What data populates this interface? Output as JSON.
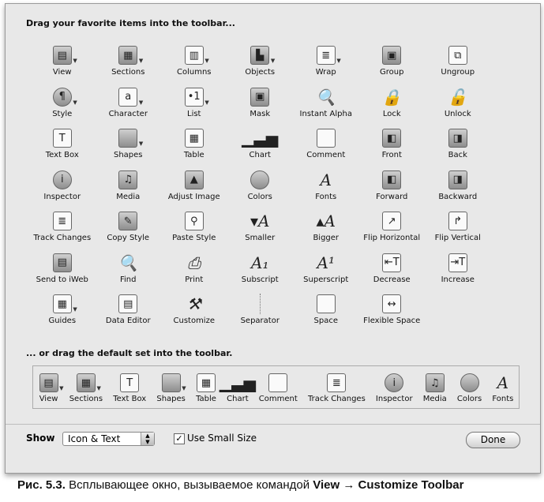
{
  "heading_all": "Drag your favorite items into the toolbar...",
  "heading_default": "... or drag the default set into the toolbar.",
  "items": [
    {
      "label": "View",
      "icon": "view-icon",
      "g": "▤",
      "t": 1
    },
    {
      "label": "Sections",
      "icon": "sections-icon",
      "g": "▦",
      "t": 1
    },
    {
      "label": "Columns",
      "icon": "columns-icon",
      "g": "▥",
      "t": 1,
      "s": "plain"
    },
    {
      "label": "Objects",
      "icon": "objects-icon",
      "g": "▙",
      "t": 1
    },
    {
      "label": "Wrap",
      "icon": "wrap-icon",
      "g": "≣",
      "t": 1,
      "s": "plain"
    },
    {
      "label": "Group",
      "icon": "group-icon",
      "g": "▣"
    },
    {
      "label": "Ungroup",
      "icon": "ungroup-icon",
      "g": "⧉",
      "s": "plain"
    },
    {
      "label": "Style",
      "icon": "style-icon",
      "g": "¶",
      "t": 1,
      "s": "round"
    },
    {
      "label": "Character",
      "icon": "character-icon",
      "g": "a",
      "t": 1,
      "s": "plain"
    },
    {
      "label": "List",
      "icon": "list-icon",
      "g": "•1",
      "t": 1,
      "s": "plain"
    },
    {
      "label": "Mask",
      "icon": "mask-icon",
      "g": "▣"
    },
    {
      "label": "Instant Alpha",
      "icon": "instant-alpha-icon",
      "g": "🔍",
      "s": "none"
    },
    {
      "label": "Lock",
      "icon": "lock-icon",
      "g": "🔒",
      "s": "none"
    },
    {
      "label": "Unlock",
      "icon": "unlock-icon",
      "g": "🔓",
      "s": "none"
    },
    {
      "label": "Text Box",
      "icon": "text-box-icon",
      "g": "T",
      "s": "plain"
    },
    {
      "label": "Shapes",
      "icon": "shapes-icon",
      "g": "",
      "t": 1
    },
    {
      "label": "Table",
      "icon": "table-icon",
      "g": "▦",
      "s": "plain"
    },
    {
      "label": "Chart",
      "icon": "chart-icon",
      "g": "▁▃▅",
      "s": "none"
    },
    {
      "label": "Comment",
      "icon": "comment-icon",
      "g": "",
      "s": "plain"
    },
    {
      "label": "Front",
      "icon": "bring-front-icon",
      "g": "◧"
    },
    {
      "label": "Back",
      "icon": "send-back-icon",
      "g": "◨"
    },
    {
      "label": "Inspector",
      "icon": "inspector-icon",
      "g": "i",
      "s": "round"
    },
    {
      "label": "Media",
      "icon": "media-icon",
      "g": "♫"
    },
    {
      "label": "Adjust Image",
      "icon": "adjust-image-icon",
      "g": "▲"
    },
    {
      "label": "Colors",
      "icon": "colors-icon",
      "g": "",
      "s": "round"
    },
    {
      "label": "Fonts",
      "icon": "fonts-icon",
      "g": "A",
      "s": "none"
    },
    {
      "label": "Forward",
      "icon": "forward-icon",
      "g": "◧"
    },
    {
      "label": "Backward",
      "icon": "backward-icon",
      "g": "◨"
    },
    {
      "label": "Track Changes",
      "icon": "track-changes-icon",
      "g": "≣",
      "s": "plain"
    },
    {
      "label": "Copy Style",
      "icon": "copy-style-icon",
      "g": "✎"
    },
    {
      "label": "Paste Style",
      "icon": "paste-style-icon",
      "g": "⚲",
      "s": "plain"
    },
    {
      "label": "Smaller",
      "icon": "smaller-icon",
      "g": "▾A",
      "s": "none"
    },
    {
      "label": "Bigger",
      "icon": "bigger-icon",
      "g": "▴A",
      "s": "none"
    },
    {
      "label": "Flip Horizontal",
      "icon": "flip-horizontal-icon",
      "g": "↗",
      "s": "plain"
    },
    {
      "label": "Flip Vertical",
      "icon": "flip-vertical-icon",
      "g": "↱",
      "s": "plain"
    },
    {
      "label": "Send to iWeb",
      "icon": "send-to-iweb-icon",
      "g": "▤"
    },
    {
      "label": "Find",
      "icon": "find-icon",
      "g": "🔍",
      "s": "none"
    },
    {
      "label": "Print",
      "icon": "print-icon",
      "g": "⎙",
      "s": "none"
    },
    {
      "label": "Subscript",
      "icon": "subscript-icon",
      "g": "A₁",
      "s": "none"
    },
    {
      "label": "Superscript",
      "icon": "superscript-icon",
      "g": "A¹",
      "s": "none"
    },
    {
      "label": "Decrease",
      "icon": "decrease-indent-icon",
      "g": "⇤T",
      "s": "plain"
    },
    {
      "label": "Increase",
      "icon": "increase-indent-icon",
      "g": "⇥T",
      "s": "plain"
    },
    {
      "label": "Guides",
      "icon": "guides-icon",
      "g": "▦",
      "t": 1,
      "s": "plain"
    },
    {
      "label": "Data Editor",
      "icon": "data-editor-icon",
      "g": "▤",
      "s": "plain"
    },
    {
      "label": "Customize",
      "icon": "customize-icon",
      "g": "⚒",
      "s": "none"
    },
    {
      "label": "Separator",
      "icon": "separator-icon",
      "sep": 1
    },
    {
      "label": "Space",
      "icon": "space-icon",
      "g": "",
      "s": "plain"
    },
    {
      "label": "Flexible Space",
      "icon": "flexible-space-icon",
      "g": "↔",
      "s": "plain"
    }
  ],
  "default_items": [
    {
      "label": "View",
      "icon": "view-icon",
      "g": "▤",
      "t": 1
    },
    {
      "label": "Sections",
      "icon": "sections-icon",
      "g": "▦",
      "t": 1
    },
    {
      "label": "Text Box",
      "icon": "text-box-icon",
      "g": "T",
      "s": "plain"
    },
    {
      "label": "Shapes",
      "icon": "shapes-icon",
      "g": "",
      "t": 1
    },
    {
      "label": "Table",
      "icon": "table-icon",
      "g": "▦",
      "s": "plain"
    },
    {
      "label": "Chart",
      "icon": "chart-icon",
      "g": "▁▃▅",
      "s": "none"
    },
    {
      "label": "Comment",
      "icon": "comment-icon",
      "g": "",
      "s": "plain"
    },
    {
      "label": "Track Changes",
      "icon": "track-changes-icon",
      "g": "≣",
      "s": "plain"
    },
    {
      "label": "Inspector",
      "icon": "inspector-icon",
      "g": "i",
      "s": "round"
    },
    {
      "label": "Media",
      "icon": "media-icon",
      "g": "♫"
    },
    {
      "label": "Colors",
      "icon": "colors-icon",
      "g": "",
      "s": "round"
    },
    {
      "label": "Fonts",
      "icon": "fonts-icon",
      "g": "A",
      "s": "none"
    }
  ],
  "footer": {
    "show_label": "Show",
    "show_value": "Icon & Text",
    "small_size_label": "Use Small Size",
    "small_size_checked": true,
    "check_glyph": "✓",
    "done_label": "Done"
  },
  "caption": {
    "prefix": "Рис. 5.3.",
    "text": " Всплывающее окно, вызываемое командой ",
    "cmd1": "View",
    "arrow": " → ",
    "cmd2": "Customize Toolbar"
  }
}
